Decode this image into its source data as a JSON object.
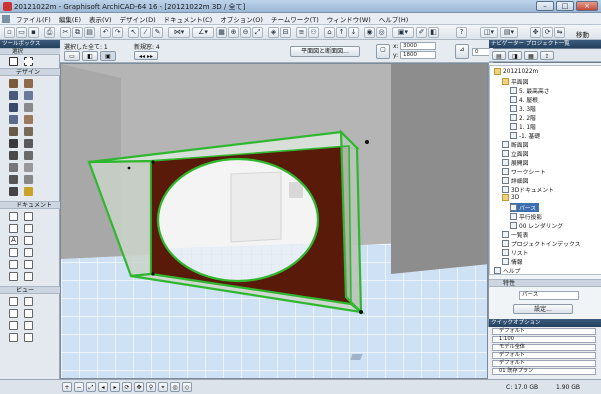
{
  "window": {
    "title": "20121022m - Graphisoft ArchiCAD-64 16 - [20121022m 3D / 全て]"
  },
  "menu": [
    "ファイル(F)",
    "編集(E)",
    "表示(V)",
    "デザイン(D)",
    "ドキュメント(C)",
    "オプション(O)",
    "チームワーク(T)",
    "ウィンドウ(W)",
    "ヘルプ(H)"
  ],
  "toolbar": {
    "right_label": "移動"
  },
  "toolbox": {
    "header": "ツールボックス",
    "select_label": "選択",
    "design_label": "デザイン",
    "document_label": "ドキュメント",
    "view_label": "ビュー"
  },
  "infobox": {
    "selection": "選択した全て: 1",
    "layer_label": "新規窓: 4",
    "button_label": "平面図と断面図...",
    "x_value": "3000",
    "y_value": "1800",
    "angle": "0"
  },
  "navigator": {
    "title": "ナビゲーター プロジェクト一覧",
    "tree": [
      {
        "label": "20121022m",
        "level": 0,
        "type": "folder"
      },
      {
        "label": "平面図",
        "level": 1,
        "type": "folder"
      },
      {
        "label": "5. 最高高さ",
        "level": 2,
        "type": "doc"
      },
      {
        "label": "4. 屋根",
        "level": 2,
        "type": "doc"
      },
      {
        "label": "3. 3階",
        "level": 2,
        "type": "doc"
      },
      {
        "label": "2. 2階",
        "level": 2,
        "type": "doc"
      },
      {
        "label": "1. 1階",
        "level": 2,
        "type": "doc"
      },
      {
        "label": "-1. 基礎",
        "level": 2,
        "type": "doc"
      },
      {
        "label": "断面図",
        "level": 1,
        "type": "doc"
      },
      {
        "label": "立面図",
        "level": 1,
        "type": "doc"
      },
      {
        "label": "展開図",
        "level": 1,
        "type": "doc"
      },
      {
        "label": "ワークシート",
        "level": 1,
        "type": "doc"
      },
      {
        "label": "詳細図",
        "level": 1,
        "type": "doc"
      },
      {
        "label": "3Dドキュメント",
        "level": 1,
        "type": "doc"
      },
      {
        "label": "3D",
        "level": 1,
        "type": "folder"
      },
      {
        "label": "パース",
        "level": 2,
        "type": "sel"
      },
      {
        "label": "平行投影",
        "level": 2,
        "type": "doc"
      },
      {
        "label": "00 レンダリング",
        "level": 2,
        "type": "doc"
      },
      {
        "label": "一覧表",
        "level": 1,
        "type": "doc"
      },
      {
        "label": "プロジェクトインデックス",
        "level": 1,
        "type": "doc"
      },
      {
        "label": "リスト",
        "level": 1,
        "type": "doc"
      },
      {
        "label": "情報",
        "level": 1,
        "type": "doc"
      },
      {
        "label": "ヘルプ",
        "level": 0,
        "type": "doc"
      }
    ],
    "properties_header": "特性",
    "properties_value": "パース",
    "settings_button": "設定..."
  },
  "quick_options": {
    "header": "クイックオプション",
    "rows": [
      "デフォルト",
      "1:100",
      "モデル全体",
      "デフォルト",
      "デフォルト",
      "01 既存プラン"
    ]
  },
  "status": {
    "drive": "C: 17.0 GB",
    "memory": "1.90 GB"
  },
  "colors": {
    "selection_green": "#2fb82f",
    "wall_brown": "#5a1a0a",
    "floor_blue": "#c6dcf3",
    "title_blue": "#9db8d6"
  }
}
